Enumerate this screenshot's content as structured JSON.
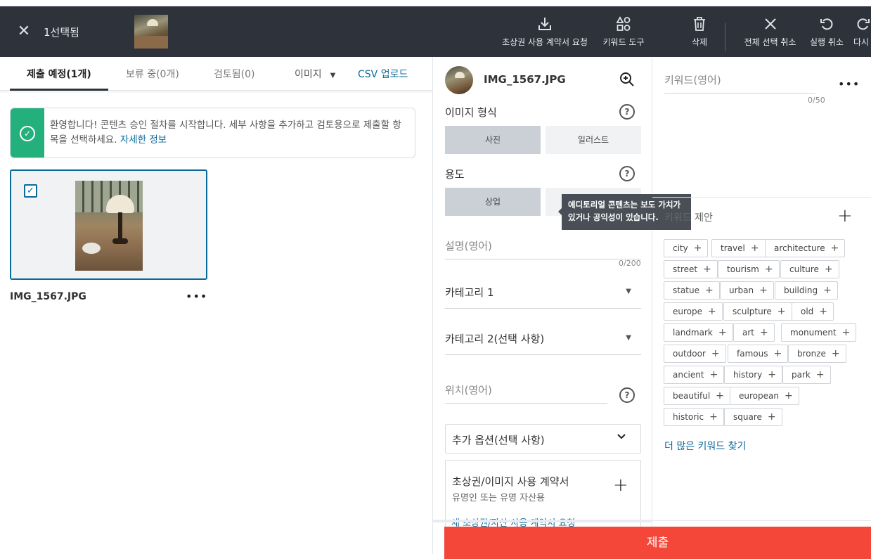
{
  "topbar": {
    "selected_text": "1선택됨",
    "tools": [
      {
        "label": "초상권 사용 계약서 요청",
        "icon": "download-tray-icon"
      },
      {
        "label": "키워드 도구",
        "icon": "shapes-icon"
      },
      {
        "label": "삭제",
        "icon": "trash-icon"
      },
      {
        "label": "전체 선택 취소",
        "icon": "close-icon"
      },
      {
        "label": "실행 취소",
        "icon": "undo-icon"
      },
      {
        "label": "다시",
        "icon": "redo-icon"
      }
    ]
  },
  "tabs": {
    "pending": "제출 예정(1개)",
    "held": "보류 중(0개)",
    "reviewed": "검토됨(0)",
    "type_filter": "이미지",
    "csv_upload": "CSV 업로드"
  },
  "banner": {
    "message": "환영합니다! 콘텐츠 승인 절차를 시작합니다. 세부 사항을 추가하고 검토용으로 제출할 항목을 선택하세요.",
    "link": "자세한 정보"
  },
  "asset": {
    "filename": "IMG_1567.JPG",
    "checked": true
  },
  "details": {
    "filename": "IMG_1567.JPG",
    "image_type_label": "이미지 형식",
    "image_type_options": [
      "사진",
      "일러스트"
    ],
    "image_type_selected": "사진",
    "usage_label": "용도",
    "usage_options": [
      "상업",
      "에디토리얼"
    ],
    "usage_selected": "상업",
    "description_placeholder": "설명(영어)",
    "description_counter": "0/200",
    "category1": "카테고리 1",
    "category2": "카테고리 2(선택 사항)",
    "location_placeholder": "위치(영어)",
    "extra_options": "추가 옵션(선택 사항)",
    "release_title": "초상권/이미지 사용 계약서",
    "release_sub": "유명인 또는 유명 자산용",
    "release_link_cut": "새 초상권/자산 사용 계약서 요청"
  },
  "tooltip": {
    "text": "에디토리얼 콘텐츠는 보도 가치가 있거나 공익성이 있습니다."
  },
  "keywords": {
    "placeholder": "키워드(영어)",
    "counter": "0/50",
    "suggest_label": "키워드 제안",
    "suggestions": [
      "city",
      "travel",
      "architecture",
      "street",
      "tourism",
      "culture",
      "statue",
      "urban",
      "building",
      "europe",
      "sculpture",
      "old",
      "landmark",
      "art",
      "monument",
      "outdoor",
      "famous",
      "bronze",
      "ancient",
      "history",
      "park",
      "beautiful",
      "european",
      "historic",
      "square"
    ],
    "more_link": "더 많은 키워드 찾기"
  },
  "submit_label": "제출",
  "colors": {
    "topbar": "#2d323b",
    "accent_link": "#0c6a9b",
    "success": "#23b07d",
    "submit": "#f4473a"
  }
}
